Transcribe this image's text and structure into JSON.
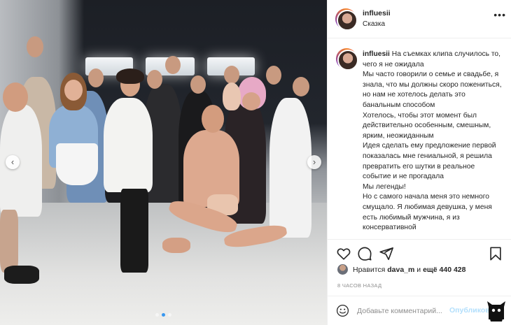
{
  "post": {
    "username": "influesii",
    "location": "Сказка",
    "more_icon": "ellipsis-icon"
  },
  "caption": {
    "username": "influesii",
    "text": " На съемках клипа случилось то, чего я не ожидала\nМы часто говорили о семье и свадьбе, я знала, что мы должны скоро пожениться, но нам не хотелось делать это банальным способом\nХотелось, чтобы этот момент был действительно особенным, смешным, ярким, неожиданным\nИдея сделать ему предложение первой показалась мне гениальной, я решила превратить его шутки в реальное событие и не прогадала\nМы легенды!\nНо с самого начала меня это немного смущало. Я любимая девушка, у меня есть любимый мужчина, я из консервативной"
  },
  "actions": {
    "like_icon": "heart-icon",
    "comment_icon": "comment-bubble-icon",
    "share_icon": "paper-plane-icon",
    "save_icon": "bookmark-icon"
  },
  "likes": {
    "prefix": "Нравится ",
    "user": "dava_m",
    "middle": " и ",
    "count": "ещё 440 428"
  },
  "time": "8 часов назад",
  "comment": {
    "placeholder": "Добавьте комментарий...",
    "post_label": "Опубликовать"
  },
  "carousel": {
    "total": 3,
    "active": 1
  },
  "colors": {
    "accent": "#3897f0",
    "post_disabled": "#b2dffc",
    "muted": "#8e8e8e",
    "text": "#262626"
  }
}
